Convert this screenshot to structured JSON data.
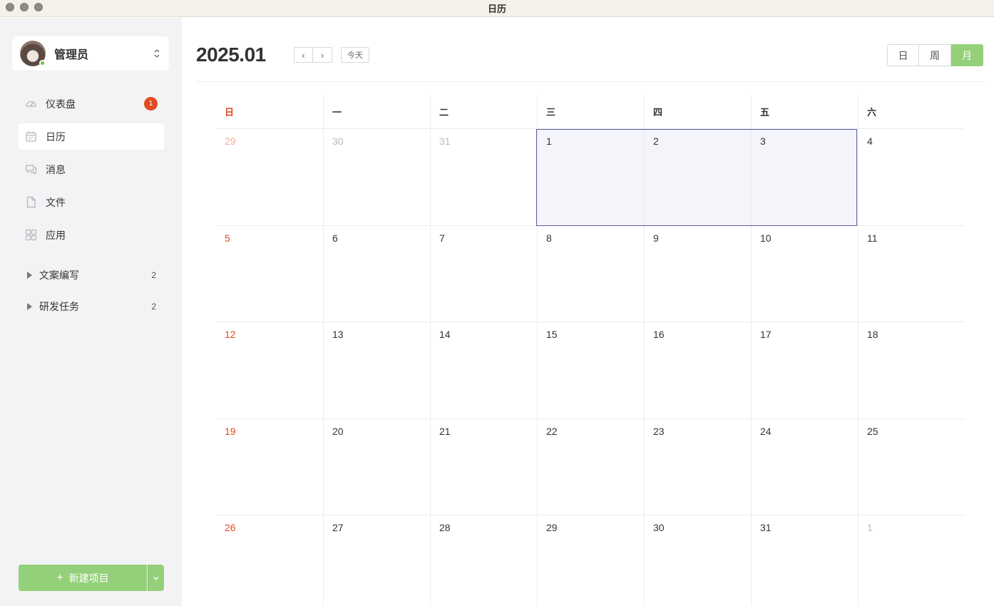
{
  "window": {
    "title": "日历"
  },
  "sidebar": {
    "user": {
      "name": "管理员"
    },
    "nav": [
      {
        "label": "仪表盘",
        "icon": "dashboard-icon",
        "badge": "1"
      },
      {
        "label": "日历",
        "icon": "calendar-icon"
      },
      {
        "label": "消息",
        "icon": "message-icon"
      },
      {
        "label": "文件",
        "icon": "file-icon"
      },
      {
        "label": "应用",
        "icon": "apps-icon"
      }
    ],
    "groups": [
      {
        "label": "文案编写",
        "count": "2"
      },
      {
        "label": "研发任务",
        "count": "2"
      }
    ],
    "new_button": {
      "plus": "+",
      "label": "新建项目"
    }
  },
  "calendar": {
    "month_title": "2025.01",
    "prev": "‹",
    "next": "›",
    "today": "今天",
    "views": [
      "日",
      "周",
      "月"
    ],
    "active_view": "月",
    "weekdays": [
      "日",
      "一",
      "二",
      "三",
      "四",
      "五",
      "六"
    ],
    "weeks": [
      [
        "29",
        "30",
        "31",
        "1",
        "2",
        "3",
        "4"
      ],
      [
        "5",
        "6",
        "7",
        "8",
        "9",
        "10",
        "11"
      ],
      [
        "12",
        "13",
        "14",
        "15",
        "16",
        "17",
        "18"
      ],
      [
        "19",
        "20",
        "21",
        "22",
        "23",
        "24",
        "25"
      ],
      [
        "26",
        "27",
        "28",
        "29",
        "30",
        "31",
        "1"
      ]
    ]
  },
  "colors": {
    "accent": "#94d07a",
    "badge": "#e04a22",
    "sunday": "#e04a22",
    "selection_border": "#5b5aa8"
  }
}
